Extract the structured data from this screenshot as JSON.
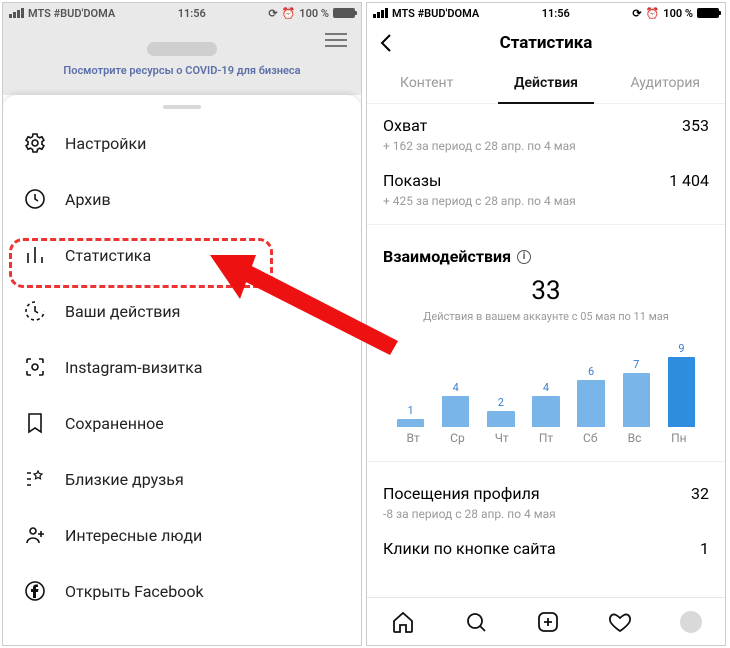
{
  "statusbar": {
    "carrier": "MTS #BUD'DOMA",
    "time": "11:56",
    "battery_pct": "100 %"
  },
  "left": {
    "covid_banner": "Посмотрите ресурсы о COVID-19 для бизнеса",
    "menu": [
      {
        "icon": "gear-icon",
        "label": "Настройки"
      },
      {
        "icon": "archive-icon",
        "label": "Архив"
      },
      {
        "icon": "stats-icon",
        "label": "Статистика"
      },
      {
        "icon": "activity-icon",
        "label": "Ваши действия"
      },
      {
        "icon": "qr-icon",
        "label": "Instagram-визитка"
      },
      {
        "icon": "bookmark-icon",
        "label": "Сохраненное"
      },
      {
        "icon": "close-friends-icon",
        "label": "Близкие друзья"
      },
      {
        "icon": "discover-people-icon",
        "label": "Интересные люди"
      },
      {
        "icon": "facebook-icon",
        "label": "Открыть Facebook"
      }
    ]
  },
  "right": {
    "title": "Статистика",
    "tabs": {
      "content": "Контент",
      "actions": "Действия",
      "audience": "Аудитория"
    },
    "reach": {
      "label": "Охват",
      "value": "353",
      "sub": "+ 162 за период с 28 апр. по 4 мая"
    },
    "impr": {
      "label": "Показы",
      "value": "1 404",
      "sub": "+ 425 за период с 28 апр. по 4 мая"
    },
    "inter": {
      "label": "Взаимодействия",
      "value": "33",
      "sub": "Действия в вашем аккаунте с 05 мая по 11 мая"
    },
    "profile_visits": {
      "label": "Посещения профиля",
      "value": "32",
      "sub": "-8 за период с 28 апр. по 4 мая"
    },
    "site_clicks": {
      "label": "Клики по кнопке сайта",
      "value": "1"
    }
  },
  "chart_data": {
    "type": "bar",
    "title": "Взаимодействия",
    "categories": [
      "Вт",
      "Ср",
      "Чт",
      "Пт",
      "Сб",
      "Вс",
      "Пн"
    ],
    "values": [
      1,
      4,
      2,
      4,
      6,
      7,
      9
    ],
    "ylim": [
      0,
      9
    ],
    "xlabel": "",
    "ylabel": ""
  },
  "colors": {
    "bar": "#7ab5ea",
    "bar_highlight": "#2f8de0",
    "highlight_red": "#e33"
  }
}
